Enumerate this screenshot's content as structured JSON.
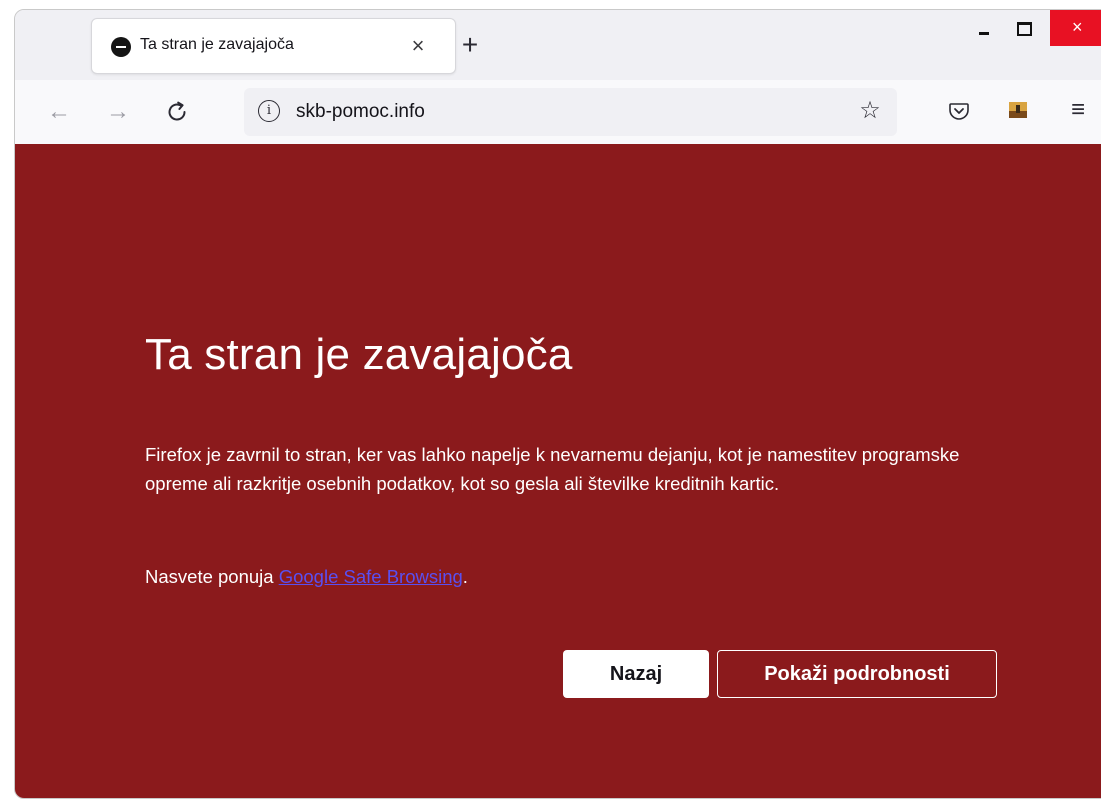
{
  "tab": {
    "title": "Ta stran je zavajajoča",
    "close_glyph": "×"
  },
  "new_tab_glyph": "+",
  "window_controls": {
    "minimize": "",
    "maximize": "",
    "close": "×"
  },
  "nav": {
    "back_glyph": "←",
    "forward_glyph": "→",
    "reload_glyph": "C"
  },
  "urlbar": {
    "info_glyph": "i",
    "url": "skb-pomoc.info",
    "star_glyph": "☆"
  },
  "toolbar": {
    "menu_glyph": "≡"
  },
  "warning": {
    "heading": "Ta stran je zavajajoča",
    "description": "Firefox je zavrnil to stran, ker vas lahko napelje k nevarnemu dejanju, kot je namestitev programske opreme ali razkritje osebnih podatkov, kot so gesla ali številke kreditnih kartic.",
    "source_prefix": "Nasvete ponuja ",
    "source_link": "Google Safe Browsing",
    "source_suffix": ".",
    "back_button": "Nazaj",
    "details_button": "Pokaži podrobnosti"
  },
  "colors": {
    "warning_background": "#8b1a1c",
    "close_button": "#e81123",
    "link": "#5a4ff0"
  }
}
